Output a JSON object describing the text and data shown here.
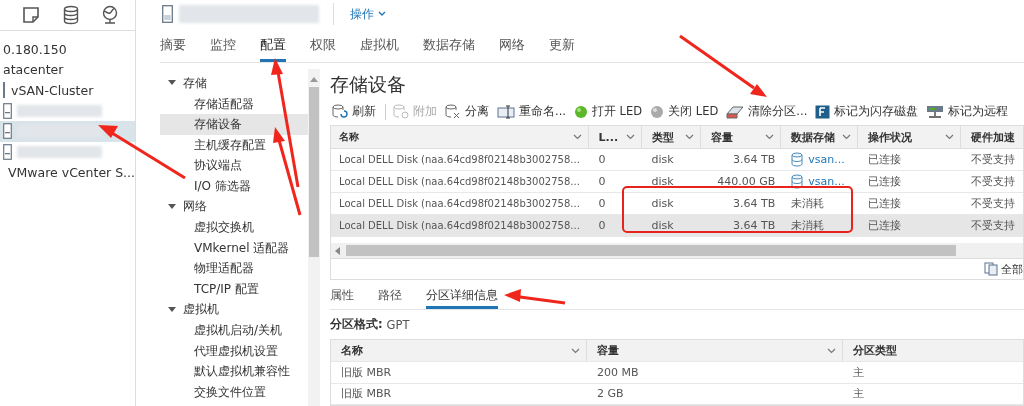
{
  "navigator": {
    "tree": [
      {
        "label": "0.180.150",
        "kind": "text",
        "selected": false
      },
      {
        "label": "atacenter",
        "kind": "text",
        "selected": false
      },
      {
        "label": "vSAN-Cluster",
        "kind": "cluster",
        "selected": false
      },
      {
        "kind": "redacted",
        "selected": false
      },
      {
        "kind": "redacted",
        "selected": true
      },
      {
        "kind": "redacted",
        "selected": false
      },
      {
        "label": "VMware vCenter S...",
        "kind": "vm",
        "selected": false
      }
    ]
  },
  "header": {
    "actions_menu": "操作"
  },
  "tabs": [
    {
      "label": "摘要",
      "selected": false
    },
    {
      "label": "监控",
      "selected": false
    },
    {
      "label": "配置",
      "selected": true
    },
    {
      "label": "权限",
      "selected": false
    },
    {
      "label": "虚拟机",
      "selected": false
    },
    {
      "label": "数据存储",
      "selected": false
    },
    {
      "label": "网络",
      "selected": false
    },
    {
      "label": "更新",
      "selected": false
    }
  ],
  "config_nav": [
    {
      "label": "存储",
      "expanded": true,
      "children": [
        {
          "label": "存储适配器",
          "selected": false
        },
        {
          "label": "存储设备",
          "selected": true
        },
        {
          "label": "主机缓存配置",
          "selected": false
        },
        {
          "label": "协议端点",
          "selected": false
        },
        {
          "label": "I/O 筛选器",
          "selected": false
        }
      ]
    },
    {
      "label": "网络",
      "expanded": true,
      "children": [
        {
          "label": "虚拟交换机",
          "selected": false
        },
        {
          "label": "VMkernel 适配器",
          "selected": false
        },
        {
          "label": "物理适配器",
          "selected": false
        },
        {
          "label": "TCP/IP 配置",
          "selected": false
        }
      ]
    },
    {
      "label": "虚拟机",
      "expanded": true,
      "children": [
        {
          "label": "虚拟机启动/关机",
          "selected": false
        },
        {
          "label": "代理虚拟机设置",
          "selected": false
        },
        {
          "label": "默认虚拟机兼容性",
          "selected": false
        },
        {
          "label": "交换文件位置",
          "selected": false
        }
      ]
    }
  ],
  "page_title": "存储设备",
  "toolbar": [
    {
      "label": "刷新",
      "kind": "refresh",
      "disabled": false
    },
    {
      "label": "附加",
      "kind": "attach",
      "disabled": true
    },
    {
      "label": "分离",
      "kind": "detach",
      "disabled": false
    },
    {
      "label": "重命名...",
      "kind": "rename",
      "disabled": false
    },
    {
      "label": "打开 LED",
      "kind": "led-on",
      "disabled": false
    },
    {
      "label": "关闭 LED",
      "kind": "led-off",
      "disabled": false
    },
    {
      "label": "清除分区...",
      "kind": "erase",
      "disabled": false
    },
    {
      "label": "标记为闪存磁盘",
      "kind": "flash",
      "disabled": false
    },
    {
      "label": "标记为远程",
      "kind": "remote",
      "disabled": false
    }
  ],
  "devices": {
    "columns": [
      "名称",
      "L...",
      "类型",
      "容量",
      "数据存储",
      "操作状况",
      "硬件加速"
    ],
    "rows": [
      {
        "name": "Local DELL Disk (naa.64cd98f02148b3002758...",
        "lun": "0",
        "type": "disk",
        "capacity": "3.64 TB",
        "datastore": {
          "text": "vsan...",
          "kind": "vsan"
        },
        "status": "已连接",
        "hw": "不受支持",
        "selected": false
      },
      {
        "name": "Local DELL Disk (naa.64cd98f02148b3002758...",
        "lun": "0",
        "type": "disk",
        "capacity": "440.00 GB",
        "datastore": {
          "text": "vsan...",
          "kind": "vsan"
        },
        "status": "已连接",
        "hw": "不受支持",
        "selected": false
      },
      {
        "name": "Local DELL Disk (naa.64cd98f02148b3002758...",
        "lun": "0",
        "type": "disk",
        "capacity": "3.64 TB",
        "datastore": {
          "text": "未消耗",
          "kind": "plain"
        },
        "status": "已连接",
        "hw": "不受支持",
        "selected": false
      },
      {
        "name": "Local DELL Disk (naa.64cd98f02148b3002758...",
        "lun": "0",
        "type": "disk",
        "capacity": "3.64 TB",
        "datastore": {
          "text": "未消耗",
          "kind": "plain"
        },
        "status": "已连接",
        "hw": "不受支持",
        "selected": true
      }
    ],
    "export": "全部"
  },
  "detail_tabs": [
    {
      "label": "属性",
      "selected": false
    },
    {
      "label": "路径",
      "selected": false
    },
    {
      "label": "分区详细信息",
      "selected": true
    }
  ],
  "partition_format": {
    "label": "分区格式:",
    "value": "GPT"
  },
  "partitions": {
    "columns": [
      "名称",
      "容量",
      "分区类型"
    ],
    "rows": [
      {
        "name": "旧版 MBR",
        "capacity": "200 MB",
        "type": "主"
      },
      {
        "name": "旧版 MBR",
        "capacity": "2 GB",
        "type": "主"
      }
    ]
  }
}
